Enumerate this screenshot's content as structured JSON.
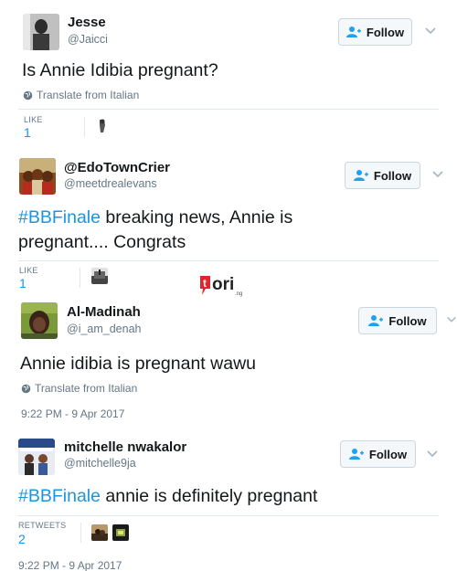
{
  "tweets": [
    {
      "name": "Jesse",
      "handle": "@Jaicci",
      "text": "Is Annie Idibia pregnant?",
      "translate": "Translate from Italian",
      "stat_label": "LIKE",
      "stat_value": "1",
      "follow_label": "Follow"
    },
    {
      "name": "@EdoTownCrier",
      "handle": "@meetdrealevans",
      "hashtag": "#BBFinale",
      "text_line1_rest": " breaking news, Annie is",
      "text_line2": "pregnant.... Congrats",
      "stat_label": "LIKE",
      "stat_value": "1",
      "follow_label": "Follow"
    },
    {
      "name": "Al-Madinah",
      "handle": "@i_am_denah",
      "text": "Annie idibia is pregnant wawu",
      "translate": "Translate from Italian",
      "timestamp": "9:22 PM - 9 Apr 2017",
      "follow_label": "Follow"
    },
    {
      "name": "mitchelle nwakalor",
      "handle": "@mitchelle9ja",
      "hashtag": "#BBFinale",
      "text_rest": " annie is definitely pregnant",
      "stat_label": "RETWEETS",
      "stat_value": "2",
      "timestamp": "9:22 PM - 9 Apr 2017",
      "follow_label": "Follow"
    }
  ],
  "watermark": {
    "text": "tori",
    "sub": ".ng"
  },
  "colors": {
    "link": "#1b95e0",
    "muted": "#657786",
    "brand": "#e0262b"
  }
}
